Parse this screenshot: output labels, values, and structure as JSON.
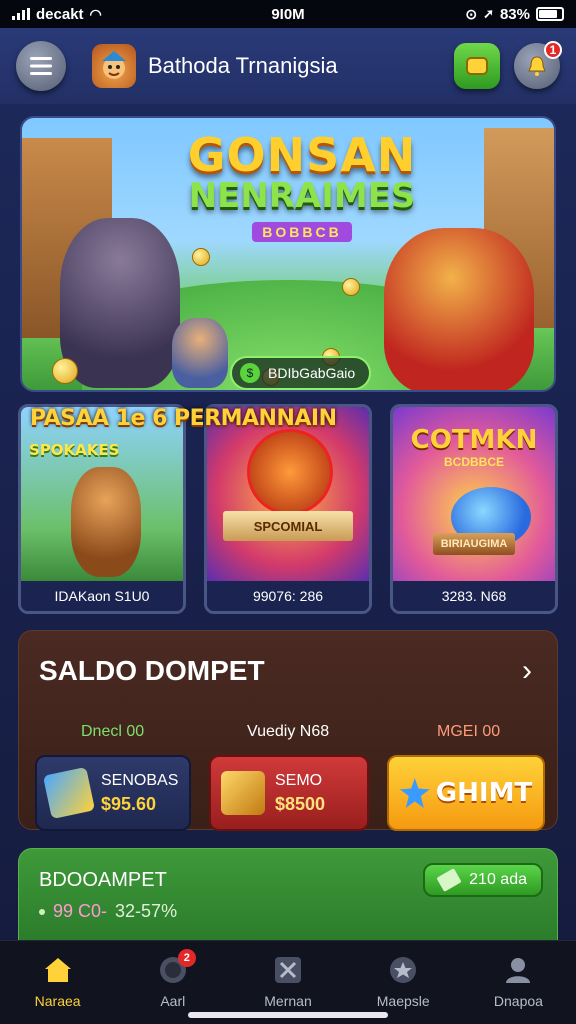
{
  "status_bar": {
    "carrier": "decakt",
    "time": "9I0M",
    "battery": "83%"
  },
  "header": {
    "app_title": "Bathoda Trnanigsia",
    "notification_count": "1",
    "icons": {
      "menu": "hamburger-menu-icon",
      "logo": "game-mascot-logo",
      "wallet": "wallet-icon",
      "notifications": "bell-icon"
    }
  },
  "hero": {
    "title": "GONSAN",
    "subtitle": "NENRAIMES",
    "tag": "BOBBCB",
    "button_label": "BDIbGabGaio",
    "sky_color": "#7fc8ff",
    "title_color": "#ffcf2e"
  },
  "games": {
    "section_title": "PASAA 1e 6 PERMANNAIN",
    "cards": [
      {
        "head": "SPOKAKES",
        "sub": "",
        "ribbon": "",
        "footer": "IDAKaon S1U0"
      },
      {
        "head": "",
        "sub": "",
        "ribbon": "SPCOMIAL",
        "footer": "99076: 286"
      },
      {
        "head": "COTMKN",
        "sub": "BCDBBCE",
        "ribbon": "BIRIAUGIMA",
        "footer": "3283. N68"
      }
    ]
  },
  "saldo": {
    "title": "SALDO DOMPET",
    "label_1": "Dnecl 00",
    "label_2": "Vuediy N68",
    "label_3": "MGEI 00",
    "card_1": {
      "name": "SENOBAS",
      "amount": "$95.60"
    },
    "card_2": {
      "name": "SEMO",
      "amount": "$8500"
    },
    "card_3": {
      "label": "GHIMT"
    }
  },
  "green_panel": {
    "title": "BDOOAMPET",
    "pill_value": "210 ada",
    "row_value_1": "99 C0-",
    "row_value_2": "32-57%"
  },
  "bottom_nav": {
    "items": [
      {
        "label": "Naraea",
        "icon": "home-icon"
      },
      {
        "label": "Aarl",
        "icon": "chat-icon",
        "badge": "2"
      },
      {
        "label": "Mernan",
        "icon": "crossed-swords-icon"
      },
      {
        "label": "Maepsle",
        "icon": "star-badge-icon"
      },
      {
        "label": "Dnapoa",
        "icon": "profile-icon"
      }
    ]
  }
}
